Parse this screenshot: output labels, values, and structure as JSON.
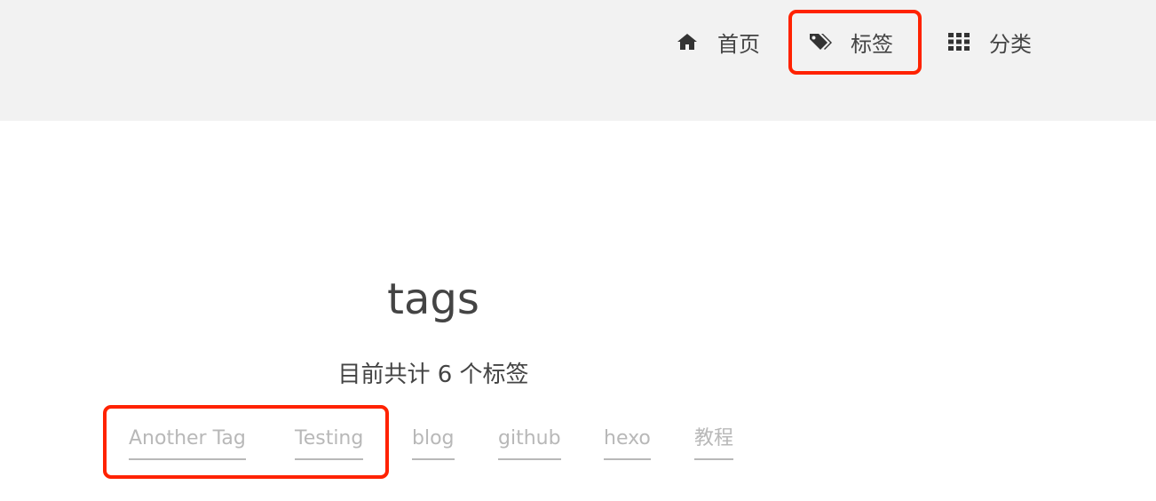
{
  "nav": {
    "items": [
      {
        "label": "首页",
        "icon": "home-icon"
      },
      {
        "label": "标签",
        "icon": "tags-icon"
      },
      {
        "label": "分类",
        "icon": "grid-icon"
      }
    ]
  },
  "page": {
    "title": "tags",
    "count_text": "目前共计 6 个标签"
  },
  "tags": [
    {
      "label": "Another Tag"
    },
    {
      "label": "Testing"
    },
    {
      "label": "blog"
    },
    {
      "label": "github"
    },
    {
      "label": "hexo"
    },
    {
      "label": "教程"
    }
  ],
  "colors": {
    "header_bg": "#f2f2f2",
    "text": "#444444",
    "tag": "#b8b8b8",
    "annotation": "#ff2200"
  }
}
